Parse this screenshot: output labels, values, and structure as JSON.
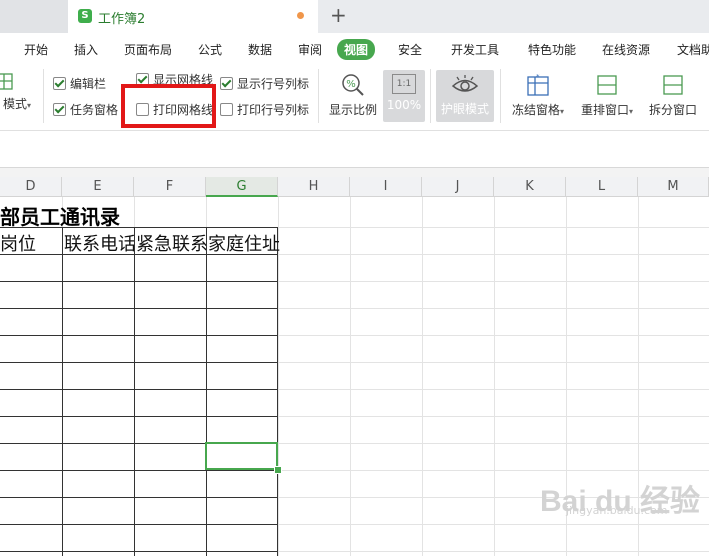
{
  "titlebar": {
    "tab_title": "工作簿2",
    "logo_letter": "S",
    "new_tab": "+"
  },
  "menu": [
    "开始",
    "插入",
    "页面布局",
    "公式",
    "数据",
    "审阅",
    "视图",
    "安全",
    "开发工具",
    "特色功能",
    "在线资源",
    "文档助"
  ],
  "menu_active_index": 6,
  "toolbar": {
    "view_mode_label": "模式",
    "checkboxes": [
      {
        "label": "编辑栏",
        "checked": true
      },
      {
        "label": "任务窗格",
        "checked": true
      },
      {
        "label": "显示网格线",
        "checked": true
      },
      {
        "label": "打印网格线",
        "checked": false
      },
      {
        "label": "显示行号列标",
        "checked": true
      },
      {
        "label": "打印行号列标",
        "checked": false
      }
    ],
    "zoom_label": "显示比例",
    "zoom_100": "100%",
    "zoom_icon_text": "1:1",
    "eye_mode": "护眼模式",
    "freeze": "冻结窗格",
    "arrange": "重排窗口",
    "split": "拆分窗口"
  },
  "columns": [
    "D",
    "E",
    "F",
    "G",
    "H",
    "I",
    "J",
    "K",
    "L",
    "M"
  ],
  "selected_column": "G",
  "sheet": {
    "title": "内部员工通讯录",
    "headers": [
      "岗位",
      "联系电话",
      "紧急联系人",
      "家庭住址"
    ]
  },
  "watermark": {
    "brand": "Bai du 经验",
    "sub": "jingyan.baidu.com"
  },
  "colors": {
    "accent": "#47a74e",
    "highlight": "#e21818"
  }
}
